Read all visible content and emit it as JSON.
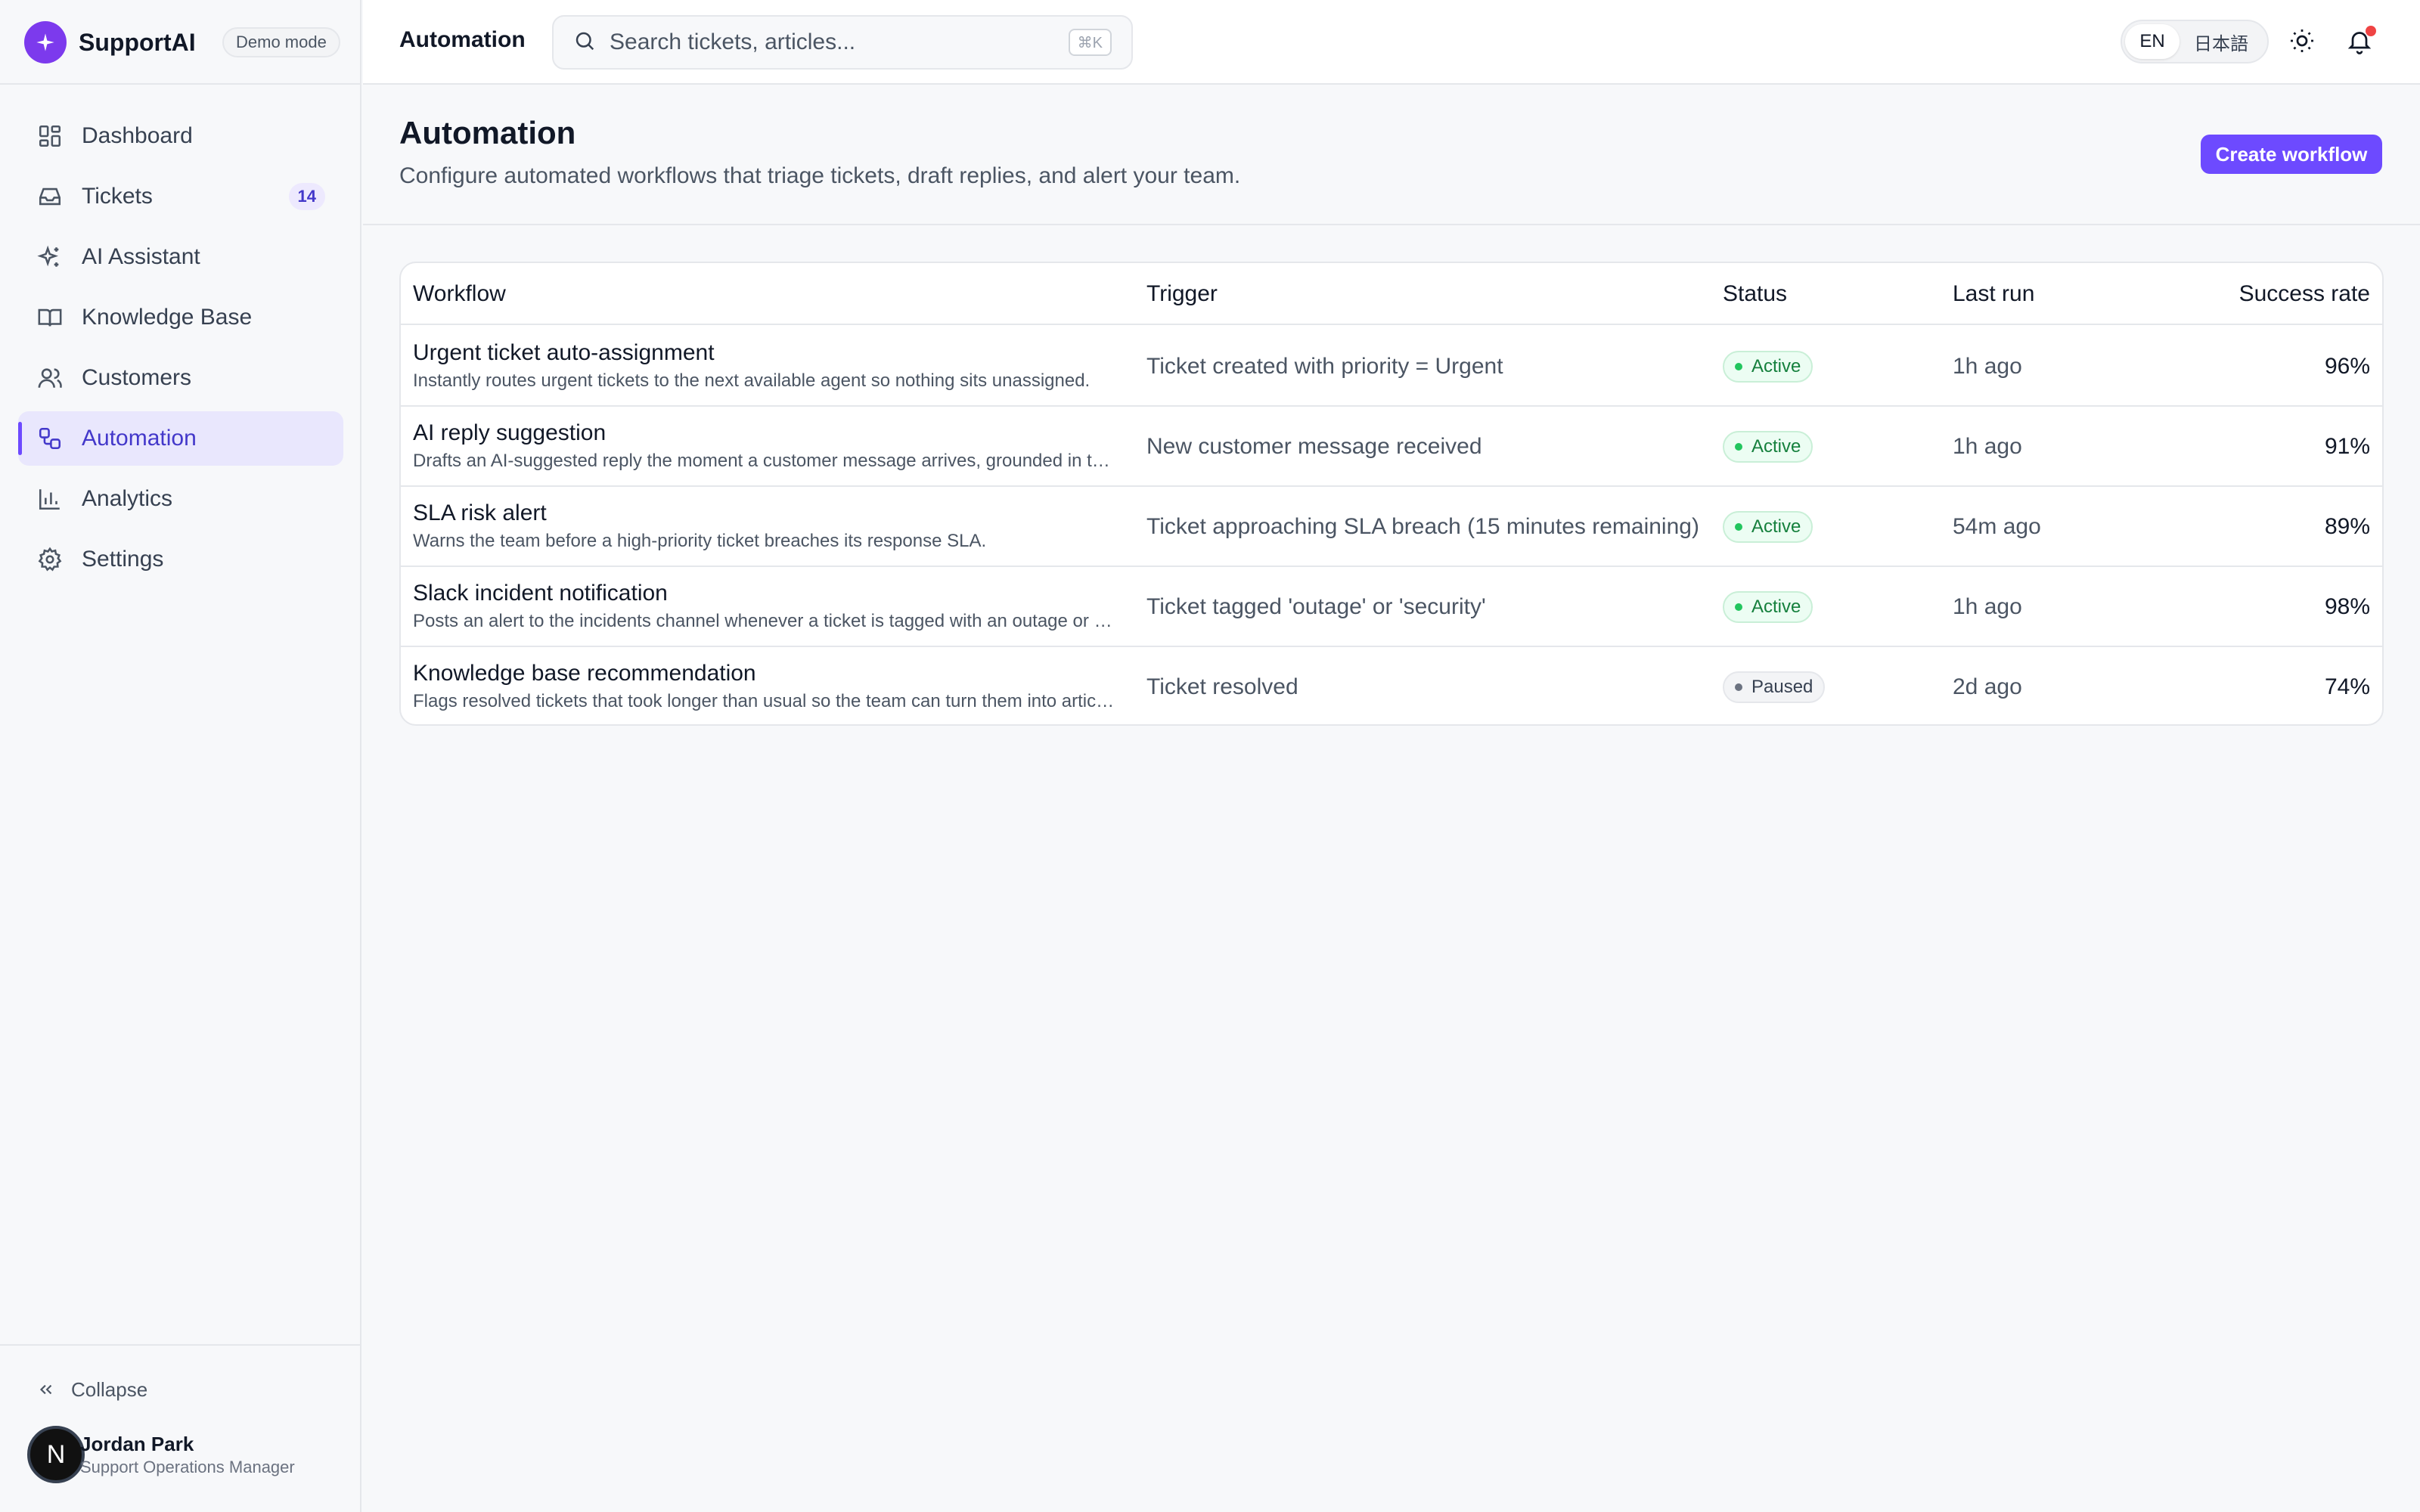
{
  "app": {
    "brand": "SupportAI",
    "demo_badge": "Demo mode"
  },
  "sidebar": {
    "items": [
      {
        "label": "Dashboard",
        "icon": "dashboard-icon"
      },
      {
        "label": "Tickets",
        "icon": "inbox-icon",
        "badge": "14"
      },
      {
        "label": "AI Assistant",
        "icon": "sparkles-icon"
      },
      {
        "label": "Knowledge Base",
        "icon": "book-icon"
      },
      {
        "label": "Customers",
        "icon": "users-icon"
      },
      {
        "label": "Automation",
        "icon": "workflow-icon",
        "active": true
      },
      {
        "label": "Analytics",
        "icon": "bar-chart-icon"
      },
      {
        "label": "Settings",
        "icon": "gear-icon"
      }
    ],
    "collapse_label": "Collapse",
    "user": {
      "initial": "N",
      "name": "Jordan Park",
      "role": "Support Operations Manager"
    }
  },
  "topbar": {
    "title": "Automation",
    "search_placeholder": "Search tickets, articles...",
    "search_shortcut": "⌘K",
    "lang_selected": "EN",
    "lang_other": "日本語"
  },
  "page": {
    "title": "Automation",
    "subtitle": "Configure automated workflows that triage tickets, draft replies, and alert your team.",
    "create_button": "Create workflow"
  },
  "table": {
    "columns": [
      "Workflow",
      "Trigger",
      "Status",
      "Last run",
      "Success rate"
    ],
    "rows": [
      {
        "name": "Urgent ticket auto-assignment",
        "desc": "Instantly routes urgent tickets to the next available agent so nothing sits unassigned.",
        "trigger": "Ticket created with priority = Urgent",
        "status": "Active",
        "last_run": "1h ago",
        "rate": "96%"
      },
      {
        "name": "AI reply suggestion",
        "desc": "Drafts an AI-suggested reply the moment a customer message arrives, grounded in the knowledge base.",
        "trigger": "New customer message received",
        "status": "Active",
        "last_run": "1h ago",
        "rate": "91%"
      },
      {
        "name": "SLA risk alert",
        "desc": "Warns the team before a high-priority ticket breaches its response SLA.",
        "trigger": "Ticket approaching SLA breach (15 minutes remaining)",
        "status": "Active",
        "last_run": "54m ago",
        "rate": "89%"
      },
      {
        "name": "Slack incident notification",
        "desc": "Posts an alert to the incidents channel whenever a ticket is tagged with an outage or security label.",
        "trigger": "Ticket tagged 'outage' or 'security'",
        "status": "Active",
        "last_run": "1h ago",
        "rate": "98%"
      },
      {
        "name": "Knowledge base recommendation",
        "desc": "Flags resolved tickets that took longer than usual so the team can turn them into articles.",
        "trigger": "Ticket resolved",
        "status": "Paused",
        "last_run": "2d ago",
        "rate": "74%"
      }
    ]
  },
  "colors": {
    "accent": "#6d4aff",
    "active_status": "#15803d",
    "paused_status": "#374151",
    "notification": "#ef4444"
  }
}
